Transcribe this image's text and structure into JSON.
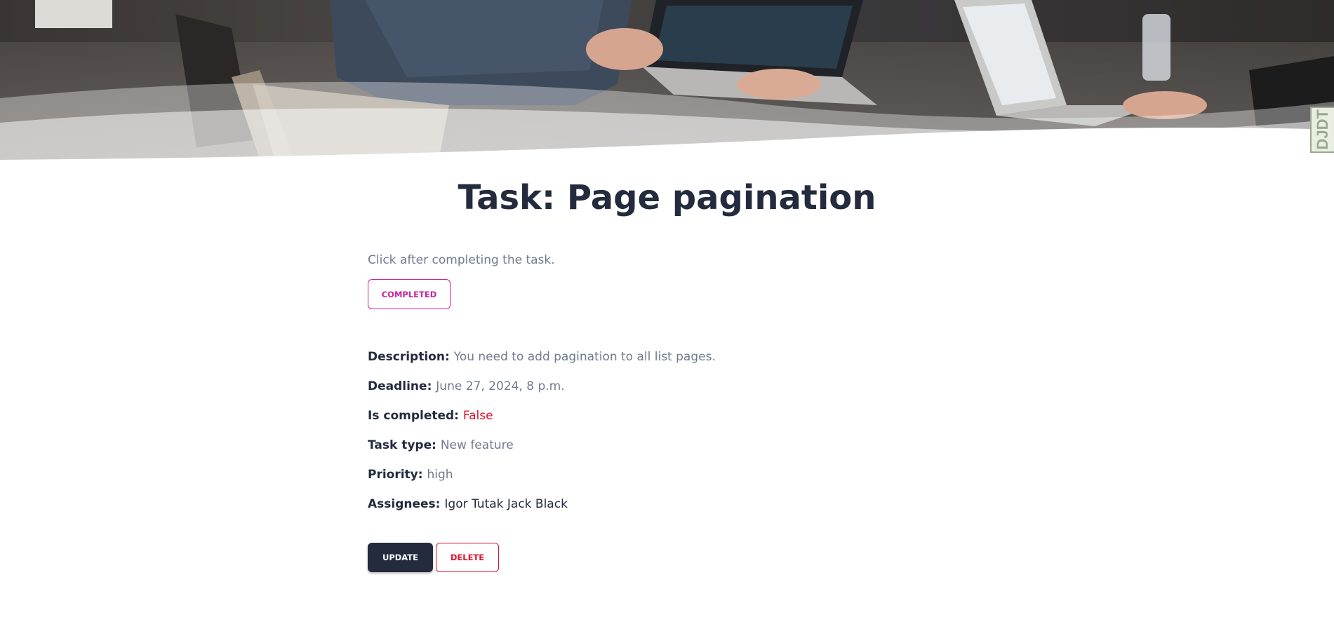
{
  "debug_toolbar": {
    "label": "DJDT"
  },
  "task": {
    "title": "Task: Page pagination",
    "completion_hint": "Click after completing the task.",
    "completed_button_label": "COMPLETED",
    "details": {
      "description": {
        "label": "Description:",
        "value": "You need to add pagination to all list pages."
      },
      "deadline": {
        "label": "Deadline:",
        "value": "June 27, 2024, 8 p.m."
      },
      "is_completed": {
        "label": "Is completed:",
        "value": "False"
      },
      "task_type": {
        "label": "Task type:",
        "value": "New feature"
      },
      "priority": {
        "label": "Priority:",
        "value": "high"
      },
      "assignees": {
        "label": "Assignees:",
        "value": "Igor Tutak Jack Black"
      }
    },
    "update_button_label": "UPDATE",
    "delete_button_label": "DELETE"
  },
  "colors": {
    "heading": "#232b3d",
    "muted_text": "#717b8f",
    "accent_pink": "#c6249a",
    "danger_red": "#e0112b",
    "primary_dark": "#232b3d"
  }
}
